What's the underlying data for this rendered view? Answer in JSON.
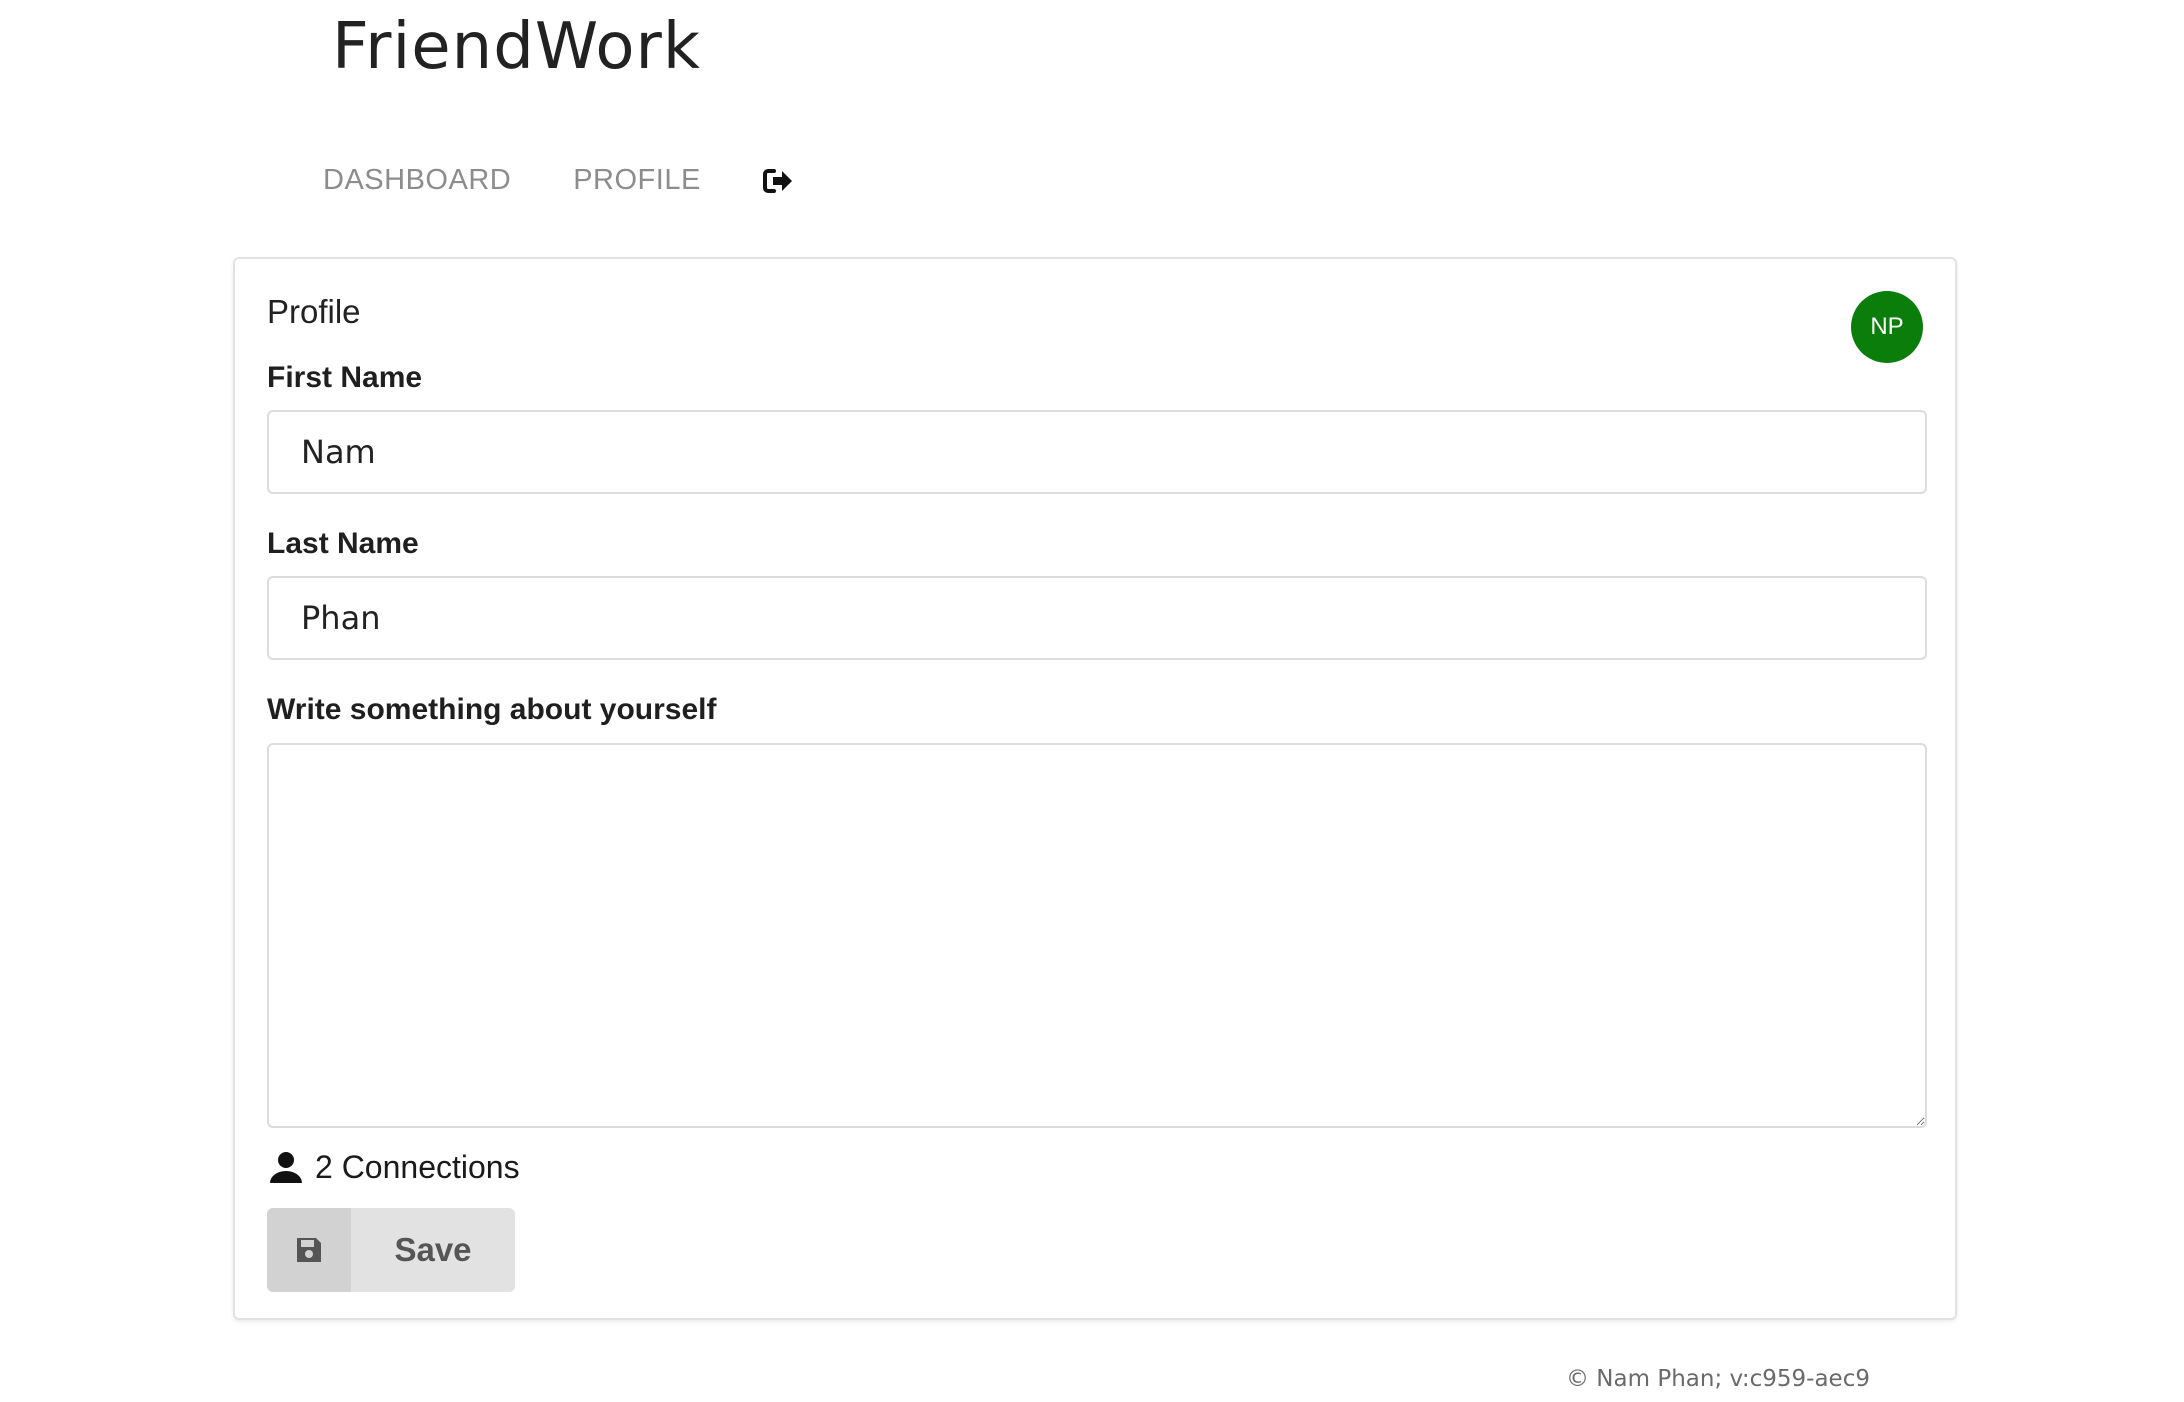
{
  "app": {
    "title": "FriendWork"
  },
  "nav": {
    "items": [
      {
        "label": "DASHBOARD"
      },
      {
        "label": "PROFILE"
      }
    ],
    "logout_icon": "sign-out-icon"
  },
  "profile": {
    "heading": "Profile",
    "avatar_initials": "NP",
    "avatar_color": "#0a7d0a",
    "first_name_label": "First Name",
    "first_name_value": "Nam",
    "last_name_label": "Last Name",
    "last_name_value": "Phan",
    "about_label": "Write something about yourself",
    "about_value": "",
    "connections_text": "2 Connections",
    "save_label": "Save"
  },
  "footer": {
    "text": "© Nam Phan; v:c959-aec9"
  }
}
